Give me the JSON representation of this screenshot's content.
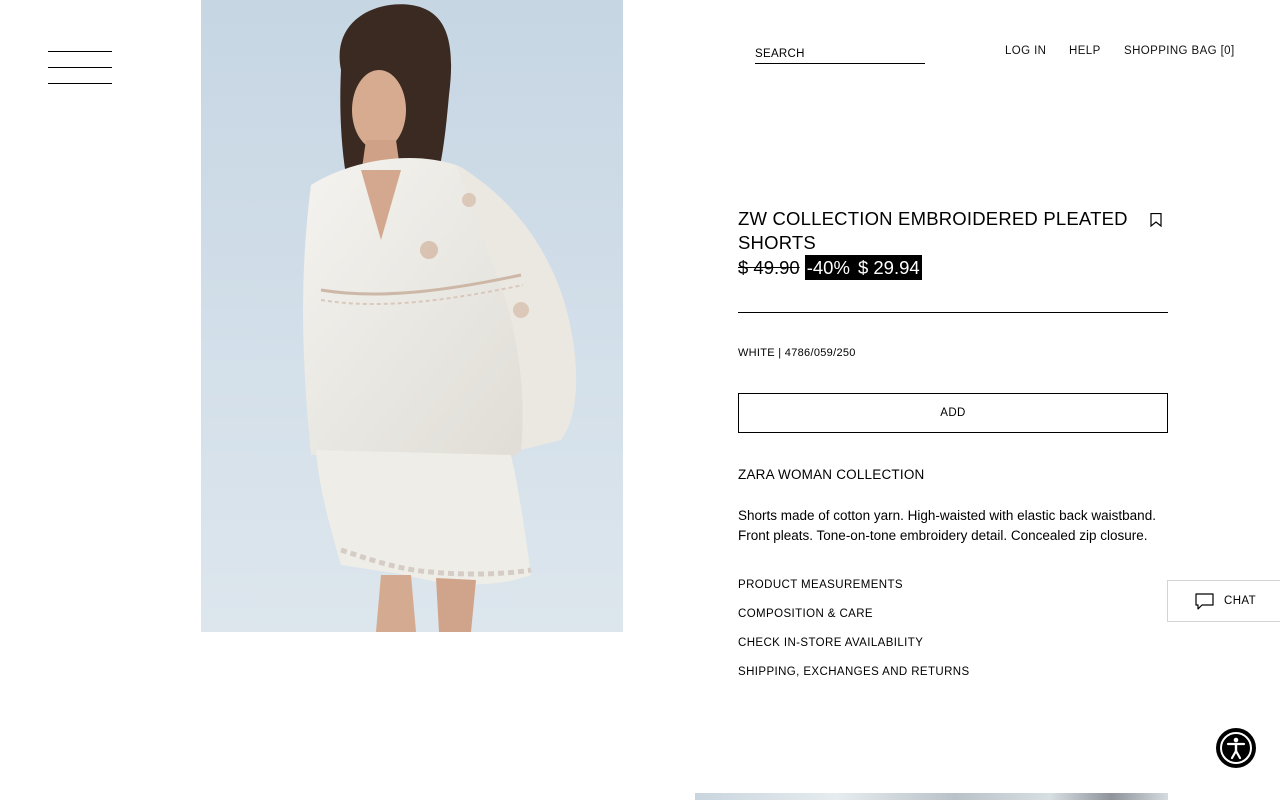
{
  "header": {
    "search_placeholder": "SEARCH",
    "login_label": "LOG IN",
    "help_label": "HELP",
    "bag_label": "SHOPPING BAG [0]"
  },
  "product": {
    "title": "ZW COLLECTION EMBROIDERED PLEATED SHORTS",
    "old_price": "$ 49.90",
    "discount": "-40%",
    "sale_price": "$ 29.94",
    "color_ref": "WHITE | 4786/059/250",
    "add_label": "ADD",
    "collection": "ZARA WOMAN COLLECTION",
    "description": "Shorts made of cotton yarn. High-waisted with elastic back waistband. Front pleats. Tone-on-tone embroidery detail. Concealed zip closure.",
    "info_links": [
      "PRODUCT MEASUREMENTS",
      "COMPOSITION & CARE",
      "CHECK IN-STORE AVAILABILITY",
      "SHIPPING, EXCHANGES AND RETURNS"
    ]
  },
  "chat": {
    "label": "CHAT"
  },
  "icons": {
    "menu": "hamburger-menu-icon",
    "bookmark": "bookmark-icon",
    "chat": "chat-bubble-icon",
    "accessibility": "accessibility-icon"
  },
  "colors": {
    "text": "#000000",
    "background": "#ffffff",
    "sale_bg": "#000000",
    "sale_text": "#ffffff"
  }
}
